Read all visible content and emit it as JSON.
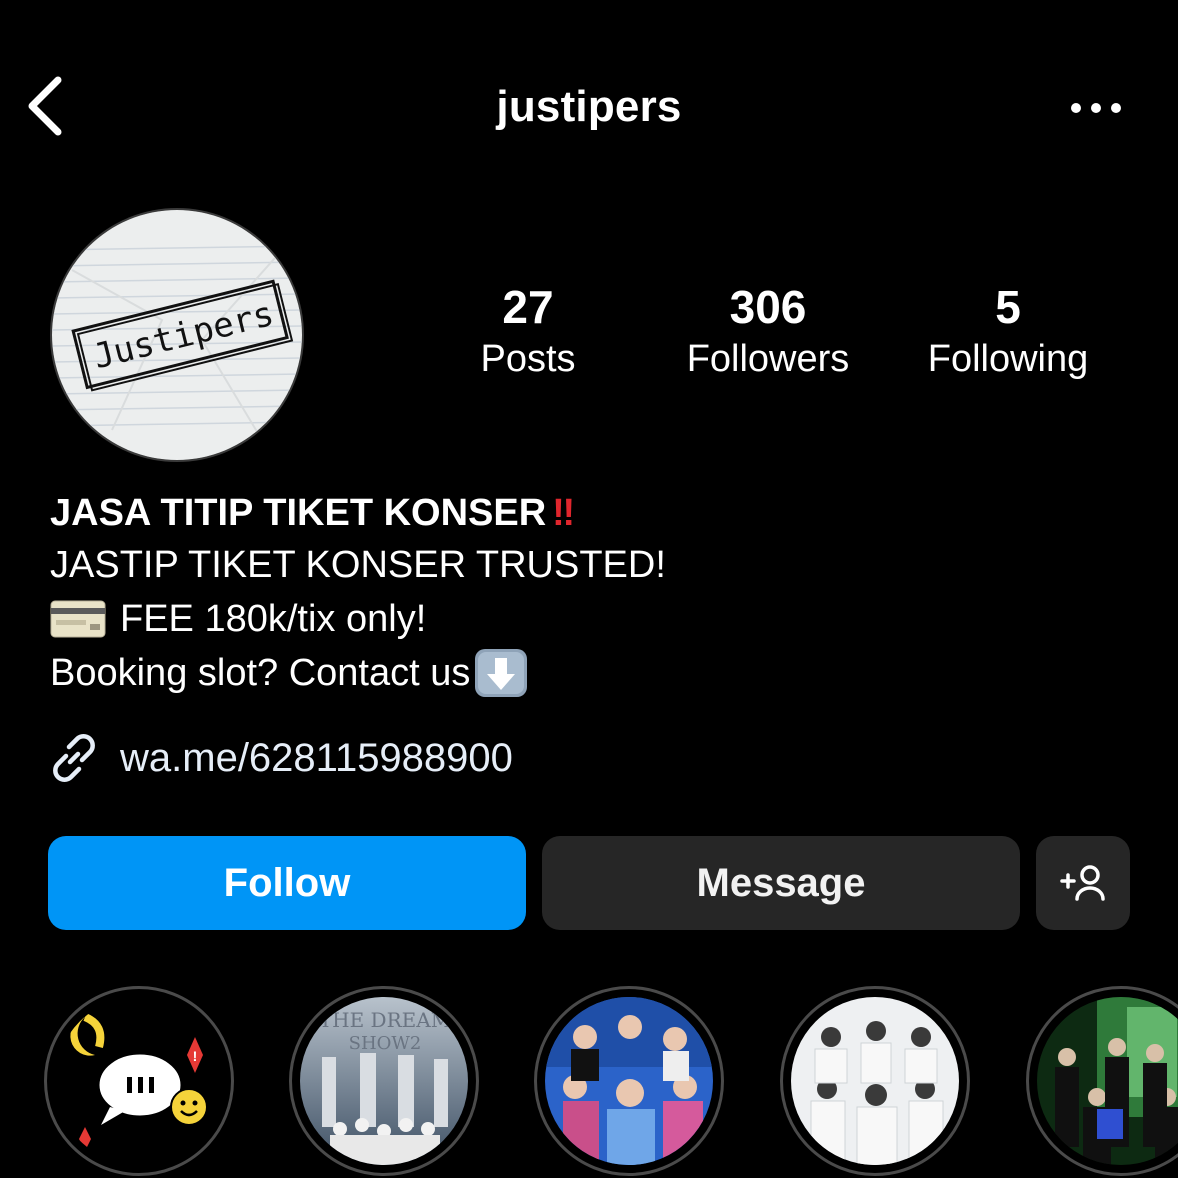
{
  "header": {
    "username": "justipers",
    "back_icon": "chevron-left-icon",
    "more_icon": "more-horizontal-icon"
  },
  "profile": {
    "avatar_text": "Justipers",
    "stats": {
      "posts": {
        "value": "27",
        "label": "Posts"
      },
      "followers": {
        "value": "306",
        "label": "Followers"
      },
      "following": {
        "value": "5",
        "label": "Following"
      }
    }
  },
  "bio": {
    "title": "JASA TITIP TIKET KONSER",
    "title_emoji": "‼",
    "line1": "JASTIP TIKET KONSER TRUSTED!",
    "line2": "FEE 180k/tix only!",
    "line3": "Booking slot? Contact us",
    "link": "wa.me/628115988900"
  },
  "actions": {
    "follow": "Follow",
    "message": "Message",
    "add_icon": "add-person-icon"
  },
  "highlights": [
    {
      "icon": "chat-bubble-sticker"
    },
    {
      "icon": "the-dream-show-2-cover"
    },
    {
      "icon": "group-photo-color"
    },
    {
      "icon": "group-photo-white"
    },
    {
      "icon": "group-photo-green"
    }
  ],
  "colors": {
    "background": "#000000",
    "follow_button": "#0095f6",
    "secondary_button": "#262626",
    "bang_red": "#e0262d"
  }
}
